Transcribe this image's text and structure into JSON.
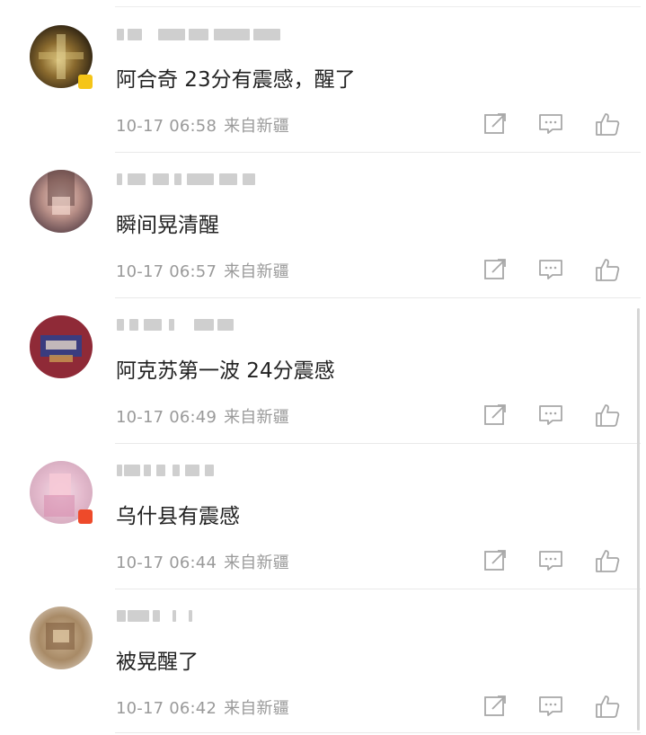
{
  "comments": [
    {
      "text": "阿合奇 23分有震感，醒了",
      "time": "10-17 06:58",
      "source": "来自新疆",
      "badge_color": "#f5c518"
    },
    {
      "text": "瞬间晃清醒",
      "time": "10-17 06:57",
      "source": "来自新疆",
      "badge_color": ""
    },
    {
      "text": "阿克苏第一波 24分震感",
      "time": "10-17 06:49",
      "source": "来自新疆",
      "badge_color": ""
    },
    {
      "text": "乌什县有震感",
      "time": "10-17 06:44",
      "source": "来自新疆",
      "badge_color": "#ee4a2a"
    },
    {
      "text": "被晃醒了",
      "time": "10-17 06:42",
      "source": "来自新疆",
      "badge_color": ""
    }
  ],
  "icons": {
    "forward": "share-icon",
    "reply": "comment-icon",
    "like": "thumbs-up-icon"
  },
  "colors": {
    "text": "#222222",
    "meta": "#9a9a9a",
    "divider": "#e9e9e9"
  }
}
